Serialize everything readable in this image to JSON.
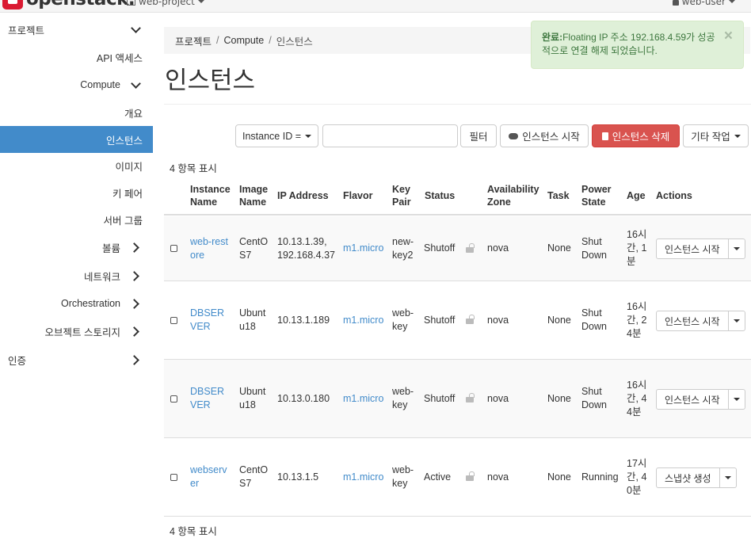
{
  "navbar": {
    "brand": "openstack.",
    "project": "web-project",
    "user": "web-user"
  },
  "sidebar": {
    "items": [
      {
        "label": "프로젝트",
        "type": "left",
        "chevron": "down"
      },
      {
        "label": "API 액세스",
        "type": "sub"
      },
      {
        "label": "Compute",
        "type": "group",
        "chevron": "down"
      },
      {
        "label": "개요",
        "type": "sub"
      },
      {
        "label": "인스턴스",
        "type": "sub",
        "active": true
      },
      {
        "label": "이미지",
        "type": "sub"
      },
      {
        "label": "키 페어",
        "type": "sub"
      },
      {
        "label": "서버 그룹",
        "type": "sub"
      },
      {
        "label": "볼륨",
        "type": "group",
        "chevron": "right"
      },
      {
        "label": "네트워크",
        "type": "group",
        "chevron": "right"
      },
      {
        "label": "Orchestration",
        "type": "group",
        "chevron": "right"
      },
      {
        "label": "오브젝트 스토리지",
        "type": "group",
        "chevron": "right"
      },
      {
        "label": "인증",
        "type": "left",
        "chevron": "right"
      }
    ]
  },
  "breadcrumb": [
    "프로젝트",
    "Compute",
    "인스턴스"
  ],
  "page_title": "인스턴스",
  "alert": {
    "strong": "완료:",
    "message": "Floating IP 주소 192.168.4.59가 성공적으로 연결 해제 되었습니다."
  },
  "toolbar": {
    "filter_select": "Instance ID =",
    "filter_value": "",
    "filter_button": "필터",
    "start_button": "인스턴스 시작",
    "delete_button": "인스턴스 삭제",
    "more_button": "기타 작업"
  },
  "count_text": "4 항목 표시",
  "table": {
    "headers": [
      "Instance Name",
      "Image Name",
      "IP Address",
      "Flavor",
      "Key Pair",
      "Status",
      "Availability Zone",
      "Task",
      "Power State",
      "Age",
      "Actions"
    ],
    "rows": [
      {
        "name": "web-restore",
        "image": "CentOS7",
        "ip": "10.13.1.39, 192.168.4.37",
        "flavor": "m1.micro",
        "key": "new-key2",
        "status": "Shutoff",
        "zone": "nova",
        "task": "None",
        "power": "Shut Down",
        "age": "16시간, 1분",
        "action": "인스턴스 시작"
      },
      {
        "name": "DBSERVER",
        "image": "Ubuntu18",
        "ip": "10.13.1.189",
        "flavor": "m1.micro",
        "key": "web-key",
        "status": "Shutoff",
        "zone": "nova",
        "task": "None",
        "power": "Shut Down",
        "age": "16시간, 24분",
        "action": "인스턴스 시작"
      },
      {
        "name": "DBSERVER",
        "image": "Ubuntu18",
        "ip": "10.13.0.180",
        "flavor": "m1.micro",
        "key": "web-key",
        "status": "Shutoff",
        "zone": "nova",
        "task": "None",
        "power": "Shut Down",
        "age": "16시간, 44분",
        "action": "인스턴스 시작"
      },
      {
        "name": "webserver",
        "image": "CentOS7",
        "ip": "10.13.1.5",
        "flavor": "m1.micro",
        "key": "web-key",
        "status": "Active",
        "zone": "nova",
        "task": "None",
        "power": "Running",
        "age": "17시간, 40분",
        "action": "스냅샷 생성"
      }
    ]
  },
  "colors": {
    "accent": "#428bca",
    "danger": "#d9534f",
    "success_bg": "#dff0d8",
    "success_text": "#3c763d"
  }
}
